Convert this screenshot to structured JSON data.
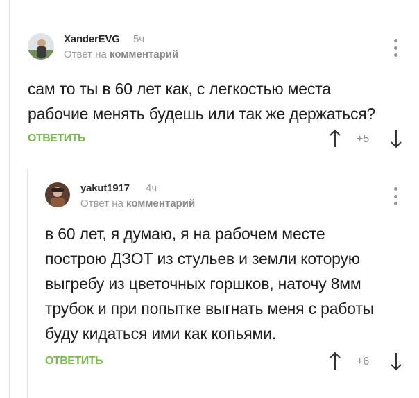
{
  "comments": [
    {
      "author": "XanderEVG",
      "time": "5ч",
      "reply_prefix": "Ответ на",
      "reply_target": "комментарий",
      "lines": [
        "сам то ты в 60 лет как, с легкостью места",
        "рабочие менять будешь или так же держаться?"
      ],
      "reply_label": "ОТВЕТИТЬ",
      "rating": "+5",
      "avatar_icon": "user-avatar-icon"
    },
    {
      "author": "yakut1917",
      "time": "4ч",
      "reply_prefix": "Ответ на",
      "reply_target": "комментарий",
      "lines": [
        "в 60 лет, я думаю, я на рабочем месте",
        "построю ДЗОТ из стульев и земли которую",
        "выгребу из цветочных горшков, наточу 8мм",
        "трубок и при попытке выгнать меня с работы",
        "буду кидаться ими как копьями."
      ],
      "reply_label": "ОТВЕТИТЬ",
      "rating": "+6",
      "avatar_icon": "user-avatar-icon"
    }
  ],
  "colors": {
    "accent_green": "#7ab94f",
    "muted_gray": "#9a9a9a",
    "text": "#1f1f1f"
  }
}
